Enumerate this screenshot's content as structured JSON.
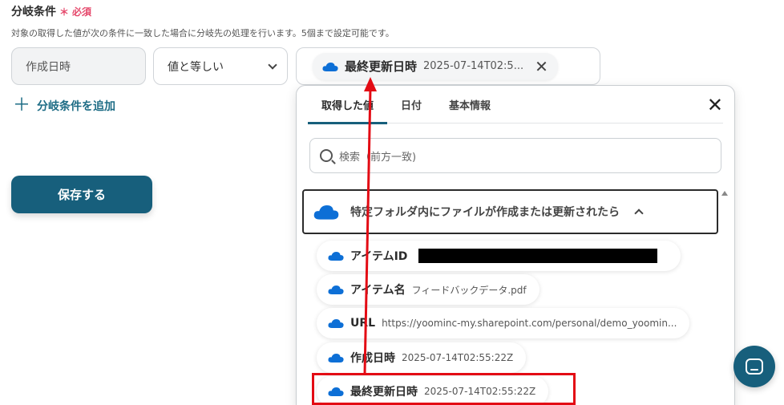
{
  "header": {
    "title": "分岐条件",
    "required_mark": "＊",
    "required_label": "必須",
    "description": "対象の取得した値が次の条件に一致した場合に分岐先の処理を行います。5個まで設定可能です。"
  },
  "condition": {
    "field_value": "作成日時",
    "operator_value": "値と等しい",
    "chip_label": "最終更新日時",
    "chip_value": "2025-07-14T02:5...",
    "chip_remove": "✕"
  },
  "add_condition": {
    "plus": "＋",
    "label": "分岐条件を追加"
  },
  "save_button": {
    "label": "保存する"
  },
  "panel": {
    "tabs": [
      {
        "label": "取得した値"
      },
      {
        "label": "日付"
      },
      {
        "label": "基本情報"
      }
    ],
    "close": "✕",
    "search_placeholder": "検索（前方一致)",
    "group_title": "特定フォルダ内にファイルが作成または更新されたら",
    "items": [
      {
        "label": "アイテムID",
        "value": ""
      },
      {
        "label": "アイテム名",
        "value": "フィードバックデータ.pdf"
      },
      {
        "label": "URL",
        "value": "https://yoominc-my.sharepoint.com/personal/demo_yoomin..."
      },
      {
        "label": "作成日時",
        "value": "2025-07-14T02:55:22Z"
      },
      {
        "label": "最終更新日時",
        "value": "2025-07-14T02:55:22Z"
      }
    ]
  },
  "colors": {
    "accent": "#175f7c",
    "required": "#e5486b",
    "annotation": "#e30b14",
    "cloud": "#0d6fd6"
  },
  "icons": {
    "cloud": "onedrive-cloud-icon",
    "chevron": "chevron-down-icon",
    "search": "search-icon",
    "chat": "chat-icon"
  }
}
